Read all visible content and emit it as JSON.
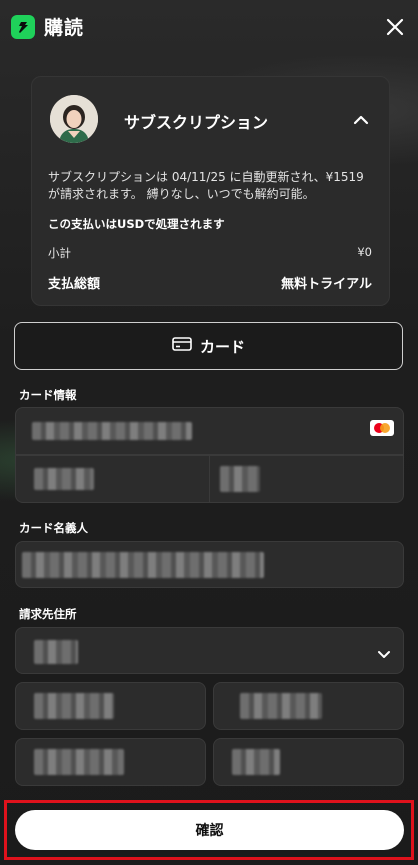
{
  "header": {
    "title": "購読",
    "logo_icon": "app-logo-icon",
    "close_icon": "close-icon",
    "brand_color": "#1fd15a"
  },
  "subscription": {
    "title": "サブスクリプション",
    "description": "サブスクリプションは 04/11/25 に自動更新され、¥1519 が請求されます。 縛りなし、いつでも解約可能。",
    "usd_note": "この支払いはUSDで処理されます",
    "subtotal_label": "小計",
    "subtotal_value": "¥0",
    "total_label": "支払総額",
    "total_value": "無料トライアル",
    "expand_icon": "chevron-up-icon"
  },
  "payment": {
    "method_label": "カード",
    "method_icon": "credit-card-icon"
  },
  "form": {
    "card_info_label": "カード情報",
    "cardholder_label": "カード名義人",
    "billing_label": "請求先住所",
    "card_brand_icon": "mastercard-icon"
  },
  "actions": {
    "confirm_label": "確認",
    "highlight_color": "#e0121c"
  }
}
